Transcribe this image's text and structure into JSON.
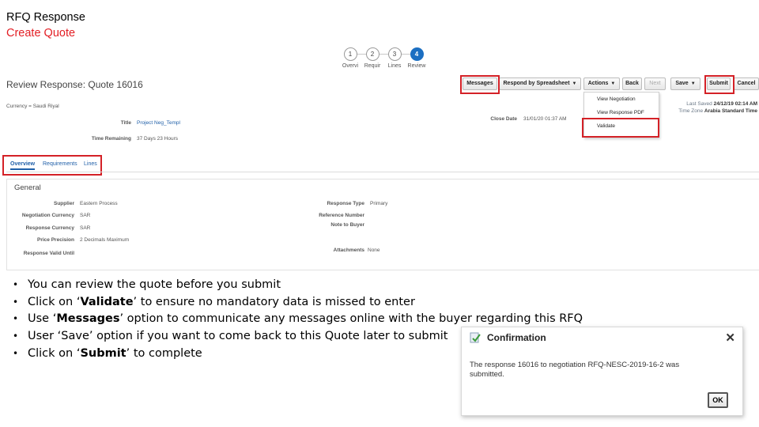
{
  "slide": {
    "title": "RFQ Response",
    "subtitle": "Create Quote",
    "subtitle_color": "#e31e24"
  },
  "train": {
    "steps": [
      {
        "num": "1",
        "label": "Overvi"
      },
      {
        "num": "2",
        "label": "Requir"
      },
      {
        "num": "3",
        "label": "Lines"
      },
      {
        "num": "4",
        "label": "Review",
        "active": true
      }
    ]
  },
  "page": {
    "heading": "Review Response: Quote 16016",
    "currency": "Currency = Saudi Riyal"
  },
  "toolbar": {
    "messages": "Messages",
    "respond_by_spreadsheet": "Respond by Spreadsheet",
    "actions": "Actions",
    "back": "Back",
    "next": "Next",
    "save": "Save",
    "submit": "Submit",
    "cancel": "Cancel"
  },
  "actions_menu": {
    "items": [
      "View Negotiation",
      "View Response PDF",
      "Validate"
    ]
  },
  "saved_info": {
    "last_saved_label": "Last Saved",
    "last_saved_value": "24/12/19 02:14 AM",
    "time_zone_label": "Time Zone",
    "time_zone_value": "Arabia Standard Time"
  },
  "header_fields": {
    "title_label": "Title",
    "title_value": "Project Neg_Templ",
    "time_remaining_label": "Time Remaining",
    "time_remaining_value": "37 Days 23 Hours",
    "close_date_label": "Close Date",
    "close_date_value": "31/01/20 01:37 AM"
  },
  "tabs": [
    "Overview",
    "Requirements",
    "Lines"
  ],
  "general": {
    "title": "General",
    "left": [
      {
        "label": "Supplier",
        "value": "Eastern Process"
      },
      {
        "label": "Negotiation Currency",
        "value": "SAR"
      },
      {
        "label": "Response Currency",
        "value": "SAR"
      },
      {
        "label": "Price Precision",
        "value": "2 Decimals Maximum"
      },
      {
        "label": "Response Valid Until",
        "value": ""
      }
    ],
    "right": [
      {
        "label": "Response Type",
        "value": "Primary"
      },
      {
        "label": "Reference Number",
        "value": ""
      },
      {
        "label": "Note to Buyer",
        "value": ""
      },
      {
        "label": "Attachments",
        "value": "None"
      }
    ]
  },
  "bullets": [
    {
      "pre": "You can review the quote before you submit",
      "em": "",
      "post": ""
    },
    {
      "pre": "Click on ‘",
      "em": "Validate",
      "post": "’ to ensure no mandatory data is missed to enter"
    },
    {
      "pre": "Use ‘",
      "em": "Messages",
      "post": "’ option to communicate any messages online with the buyer regarding this RFQ"
    },
    {
      "pre": "User ‘Save’ option if you want to come back to this Quote later to submit",
      "em": "",
      "post": ""
    },
    {
      "pre": "Click on ‘",
      "em": "Submit",
      "post": "’ to complete"
    }
  ],
  "dialog": {
    "title": "Confirmation",
    "message": "The response 16016 to negotiation RFQ-NESC-2019-16-2 was submitted.",
    "ok_label": "OK",
    "icon": "confirmation-check-icon"
  },
  "colors": {
    "highlight": "#d42127",
    "link": "#1f5fa8",
    "active_step": "#1c6fc2"
  }
}
